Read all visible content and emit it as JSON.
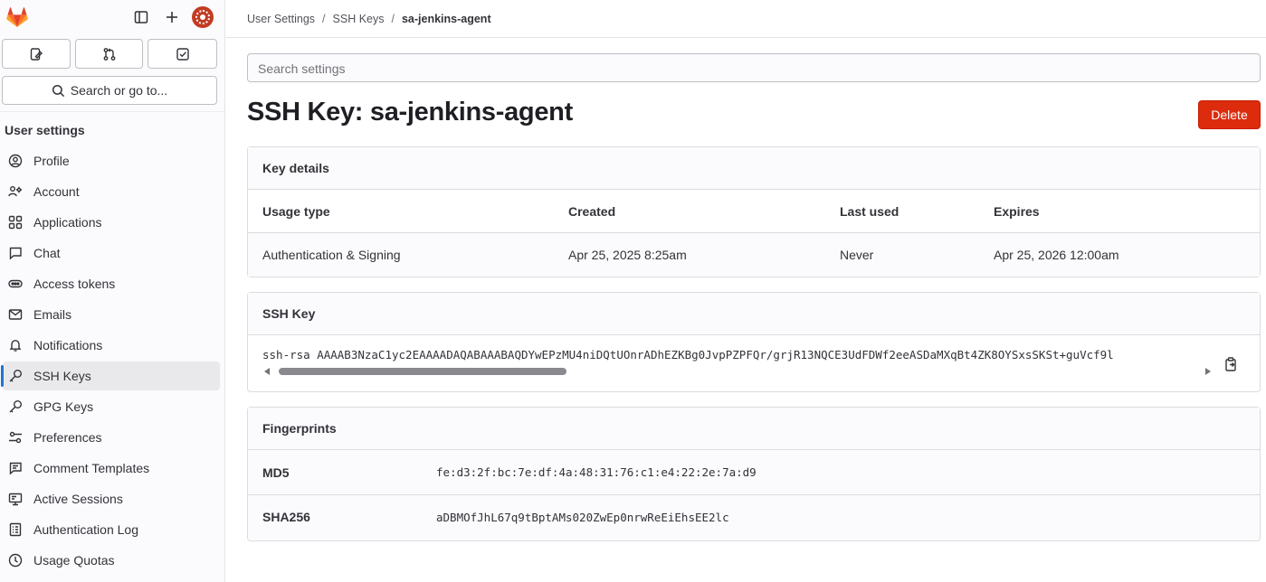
{
  "sidebar": {
    "title": "User settings",
    "search_label": "Search or go to...",
    "items": [
      {
        "label": "Profile",
        "icon": "profile-icon"
      },
      {
        "label": "Account",
        "icon": "account-icon"
      },
      {
        "label": "Applications",
        "icon": "applications-icon"
      },
      {
        "label": "Chat",
        "icon": "chat-icon"
      },
      {
        "label": "Access tokens",
        "icon": "token-icon"
      },
      {
        "label": "Emails",
        "icon": "mail-icon"
      },
      {
        "label": "Notifications",
        "icon": "bell-icon"
      },
      {
        "label": "SSH Keys",
        "icon": "key-icon",
        "active": true
      },
      {
        "label": "GPG Keys",
        "icon": "key-icon"
      },
      {
        "label": "Preferences",
        "icon": "preferences-icon"
      },
      {
        "label": "Comment Templates",
        "icon": "comment-template-icon"
      },
      {
        "label": "Active Sessions",
        "icon": "monitor-icon"
      },
      {
        "label": "Authentication Log",
        "icon": "log-icon"
      },
      {
        "label": "Usage Quotas",
        "icon": "quota-icon"
      }
    ]
  },
  "breadcrumb": {
    "items": [
      "User Settings",
      "SSH Keys"
    ],
    "current": "sa-jenkins-agent"
  },
  "search": {
    "placeholder": "Search settings"
  },
  "page": {
    "title": "SSH Key: sa-jenkins-agent",
    "delete_label": "Delete"
  },
  "key_details": {
    "header": "Key details",
    "columns": [
      "Usage type",
      "Created",
      "Last used",
      "Expires"
    ],
    "values": [
      "Authentication & Signing",
      "Apr 25, 2025 8:25am",
      "Never",
      "Apr 25, 2026 12:00am"
    ]
  },
  "ssh_key": {
    "header": "SSH Key",
    "value": "ssh-rsa AAAAB3NzaC1yc2EAAAADAQABAAABAQDYwEPzMU4niDQtUOnrADhEZKBg0JvpPZPFQr/grjR13NQCE3UdFDWf2eeASDaMXqBt4ZK8OYSxsSKSt+guVcf9l",
    "scroll_position": 0
  },
  "fingerprints": {
    "header": "Fingerprints",
    "rows": [
      {
        "label": "MD5",
        "value": "fe:d3:2f:bc:7e:df:4a:48:31:76:c1:e4:22:2e:7a:d9"
      },
      {
        "label": "SHA256",
        "value": "aDBMOfJhL67q9tBptAMs020ZwEp0nrwReEiEhsEE2lc"
      }
    ]
  },
  "colors": {
    "accent": "#1f75cb",
    "danger": "#dd2b0e",
    "brand": "#e24329"
  }
}
